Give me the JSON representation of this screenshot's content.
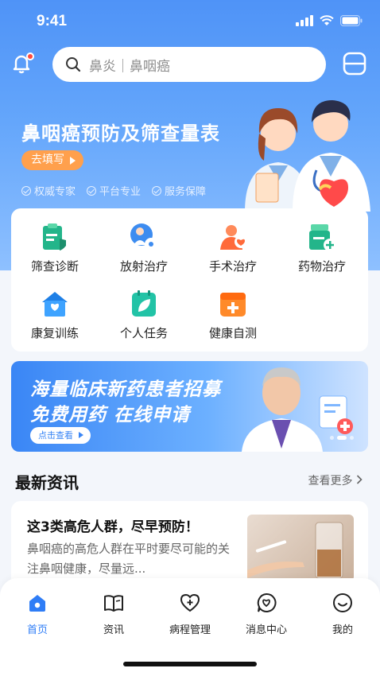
{
  "status_bar": {
    "time": "9:41"
  },
  "search": {
    "placeholder": "鼻炎｜鼻咽癌"
  },
  "banner": {
    "title": "鼻咽癌预防及筛查量表",
    "button": "去填写",
    "features": [
      "权威专家",
      "平台专业",
      "服务保障"
    ]
  },
  "services": [
    {
      "label": "筛查诊断",
      "icon": "clipboard-shield-icon"
    },
    {
      "label": "放射治疗",
      "icon": "radiation-person-icon"
    },
    {
      "label": "手术治疗",
      "icon": "surgery-heart-icon"
    },
    {
      "label": "药物治疗",
      "icon": "medicine-box-icon"
    },
    {
      "label": "康复训练",
      "icon": "house-heart-icon"
    },
    {
      "label": "个人任务",
      "icon": "leaf-calendar-icon"
    },
    {
      "label": "健康自测",
      "icon": "medical-kit-icon"
    }
  ],
  "recruit": {
    "line1": "海量临床新药患者招募",
    "line2": "免费用药  在线申请",
    "button": "点击查看"
  },
  "news": {
    "section_title": "最新资讯",
    "more": "查看更多",
    "item": {
      "title": "这3类高危人群，尽早预防！",
      "desc": "鼻咽癌的高危人群在平时要尽可能的关注鼻咽健康，尽量远..."
    }
  },
  "tabs": [
    {
      "label": "首页",
      "icon": "home-icon"
    },
    {
      "label": "资讯",
      "icon": "book-icon"
    },
    {
      "label": "病程管理",
      "icon": "heart-plus-icon"
    },
    {
      "label": "消息中心",
      "icon": "message-heart-icon"
    },
    {
      "label": "我的",
      "icon": "smiley-icon"
    }
  ],
  "colors": {
    "primary": "#2f7df6",
    "hero": "#4f93f7",
    "orange": "#ffa04d"
  }
}
